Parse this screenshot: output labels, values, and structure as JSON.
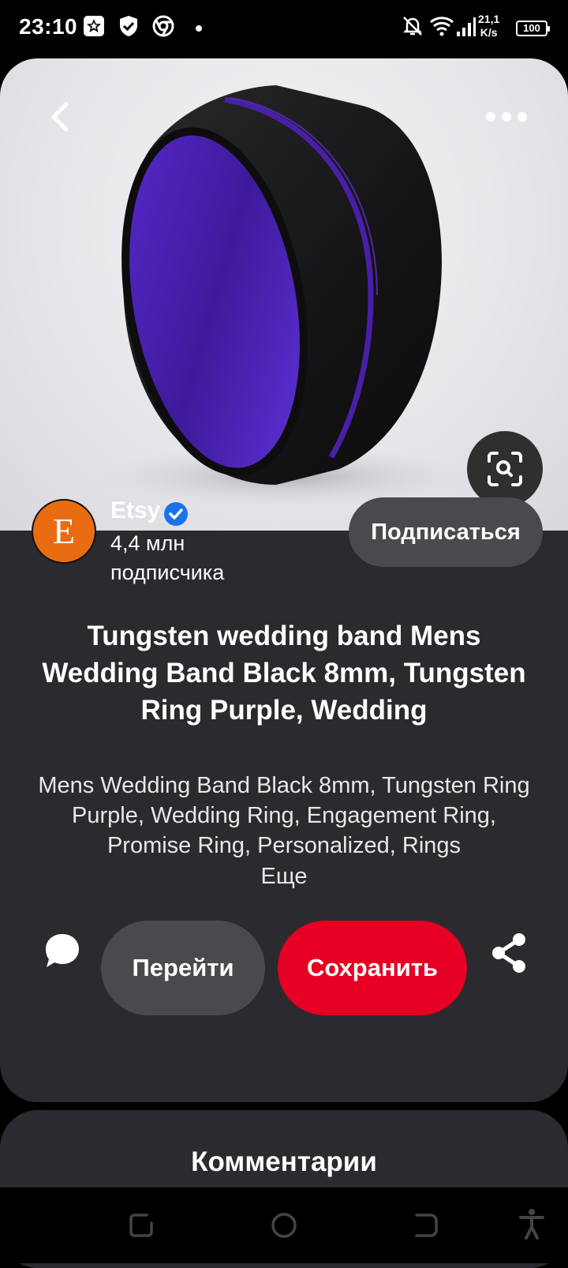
{
  "status_bar": {
    "time": "23:10",
    "icons": [
      "star-notification-icon",
      "shield-check-icon",
      "chrome-icon",
      "mute-bell-icon",
      "wifi-icon",
      "signal-icon"
    ],
    "net_speed_value": "21,1",
    "net_speed_unit": "K/s",
    "battery": "100"
  },
  "pin": {
    "image_subject": "black tungsten ring with purple inside",
    "colors": {
      "ring_black": "#1b1b1d",
      "ring_purple": "#4a1fa8"
    }
  },
  "creator": {
    "avatar_letter": "E",
    "name": "Etsy",
    "verified": true,
    "followers_line1": "4,4 млн",
    "followers_line2": "подписчика",
    "follow_label": "Подписаться",
    "colors": {
      "avatar_bg": "#e96c12",
      "verified_blue": "#1a73e8"
    }
  },
  "title": "Tungsten wedding band Mens Wedding Band Black 8mm, Tungsten Ring Purple, Wedding",
  "description": "Mens Wedding Band Black 8mm, Tungsten Ring Purple, Wedding Ring, Engagement Ring, Promise Ring, Personalized, Rings",
  "more_label": "Еще",
  "actions": {
    "visit_label": "Перейти",
    "save_label": "Сохранить",
    "colors": {
      "save_bg": "#e60023",
      "visit_bg": "#4a494d"
    }
  },
  "comments": {
    "title": "Комментарии"
  },
  "nav_bar": {
    "icons": [
      "recent-apps-icon",
      "home-icon",
      "back-icon",
      "accessibility-icon"
    ]
  }
}
